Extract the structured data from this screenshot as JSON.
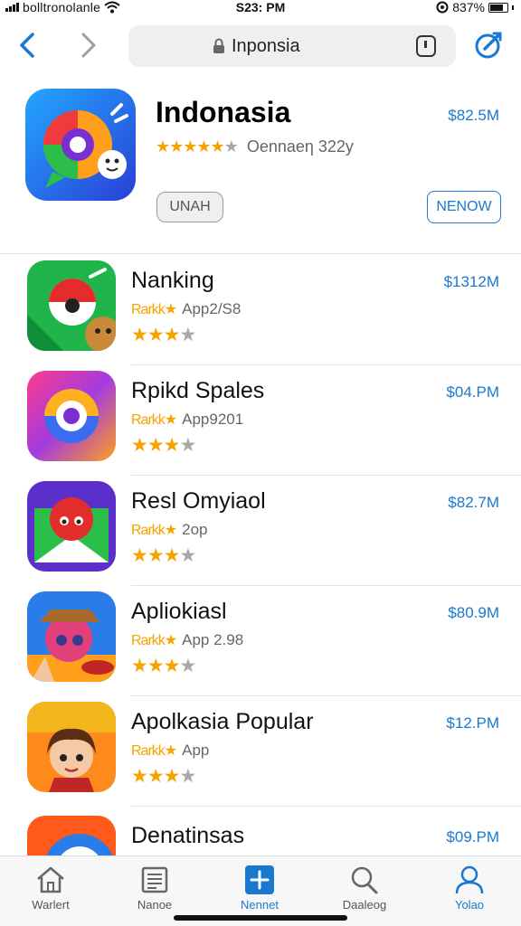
{
  "status_bar": {
    "carrier": "bolltronolanle",
    "time": "S23: PM",
    "battery": "837%"
  },
  "nav": {
    "url": "Inponsia"
  },
  "featured": {
    "title": "Indonasia",
    "rating_meta": "Oennaeη 322y",
    "price": "$82.5M",
    "left_button": "UNAH",
    "right_button": "NENOW"
  },
  "apps": [
    {
      "name": "Nanking",
      "sub_stars": "Rarkk★",
      "meta": "App2/S8",
      "price": "$1312M",
      "rating": 3.5
    },
    {
      "name": "Rpikd Spales",
      "sub_stars": "Rarkk★",
      "meta": "App9201",
      "price": "$04.PM",
      "rating": 3.5
    },
    {
      "name": "Resl Omyiaol",
      "sub_stars": "Rarkk★",
      "meta": "2op",
      "price": "$82.7M",
      "rating": 3.5
    },
    {
      "name": "Apliokiasl",
      "sub_stars": "Rarkk★",
      "meta": "App 2.98",
      "price": "$80.9M",
      "rating": 3.5
    },
    {
      "name": "Apolkasia Popular",
      "sub_stars": "Rarkk★",
      "meta": "App",
      "price": "$12.PM",
      "rating": 3.5
    },
    {
      "name": "Denatinsas",
      "sub_stars": "",
      "meta": "",
      "price": "$09.PM",
      "rating": 0
    }
  ],
  "tabs": [
    {
      "label": "Warlert",
      "icon": "home-icon",
      "active": false
    },
    {
      "label": "Nanoe",
      "icon": "news-icon",
      "active": false
    },
    {
      "label": "Nennet",
      "icon": "plus-square-icon",
      "active": true
    },
    {
      "label": "Daaleog",
      "icon": "search-icon",
      "active": false
    },
    {
      "label": "Yolao",
      "icon": "person-icon",
      "active": false
    }
  ],
  "colors": {
    "accent": "#1a78d0",
    "star": "#f5a300",
    "star_off": "#a8a8a8"
  }
}
